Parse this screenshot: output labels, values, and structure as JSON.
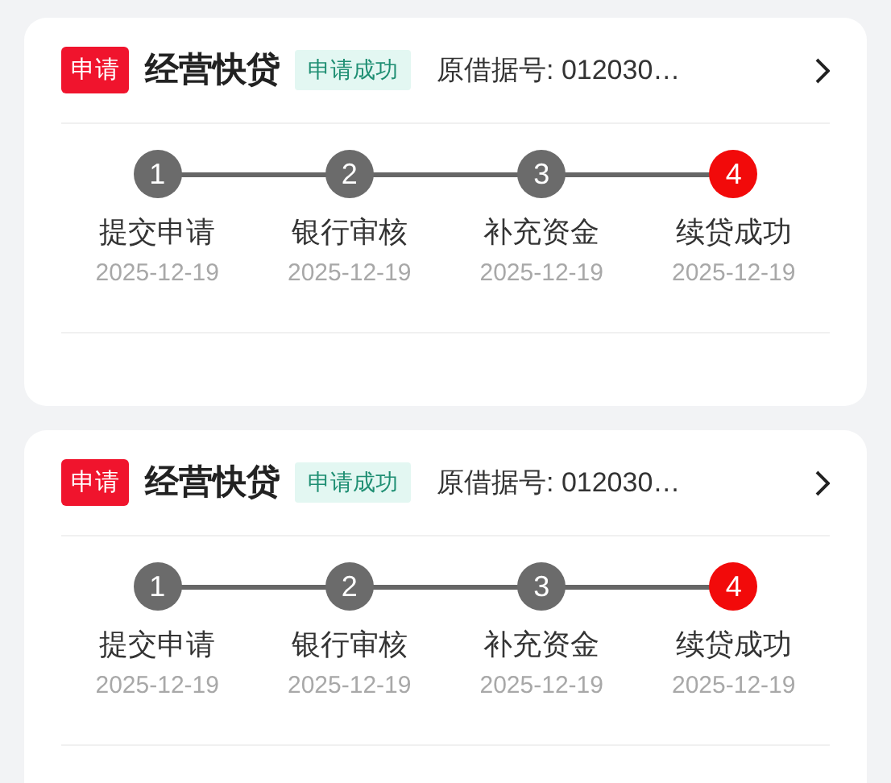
{
  "cards": [
    {
      "tag": "申请",
      "title": "经营快贷",
      "status": "申请成功",
      "reference": "原借据号: 012030…",
      "steps": [
        {
          "number": "1",
          "label": "提交申请",
          "date": "2025-12-19",
          "current": false
        },
        {
          "number": "2",
          "label": "银行审核",
          "date": "2025-12-19",
          "current": false
        },
        {
          "number": "3",
          "label": "补充资金",
          "date": "2025-12-19",
          "current": false
        },
        {
          "number": "4",
          "label": "续贷成功",
          "date": "2025-12-19",
          "current": true
        }
      ]
    },
    {
      "tag": "申请",
      "title": "经营快贷",
      "status": "申请成功",
      "reference": "原借据号: 012030…",
      "steps": [
        {
          "number": "1",
          "label": "提交申请",
          "date": "2025-12-19",
          "current": false
        },
        {
          "number": "2",
          "label": "银行审核",
          "date": "2025-12-19",
          "current": false
        },
        {
          "number": "3",
          "label": "补充资金",
          "date": "2025-12-19",
          "current": false
        },
        {
          "number": "4",
          "label": "续贷成功",
          "date": "2025-12-19",
          "current": true
        }
      ]
    }
  ]
}
